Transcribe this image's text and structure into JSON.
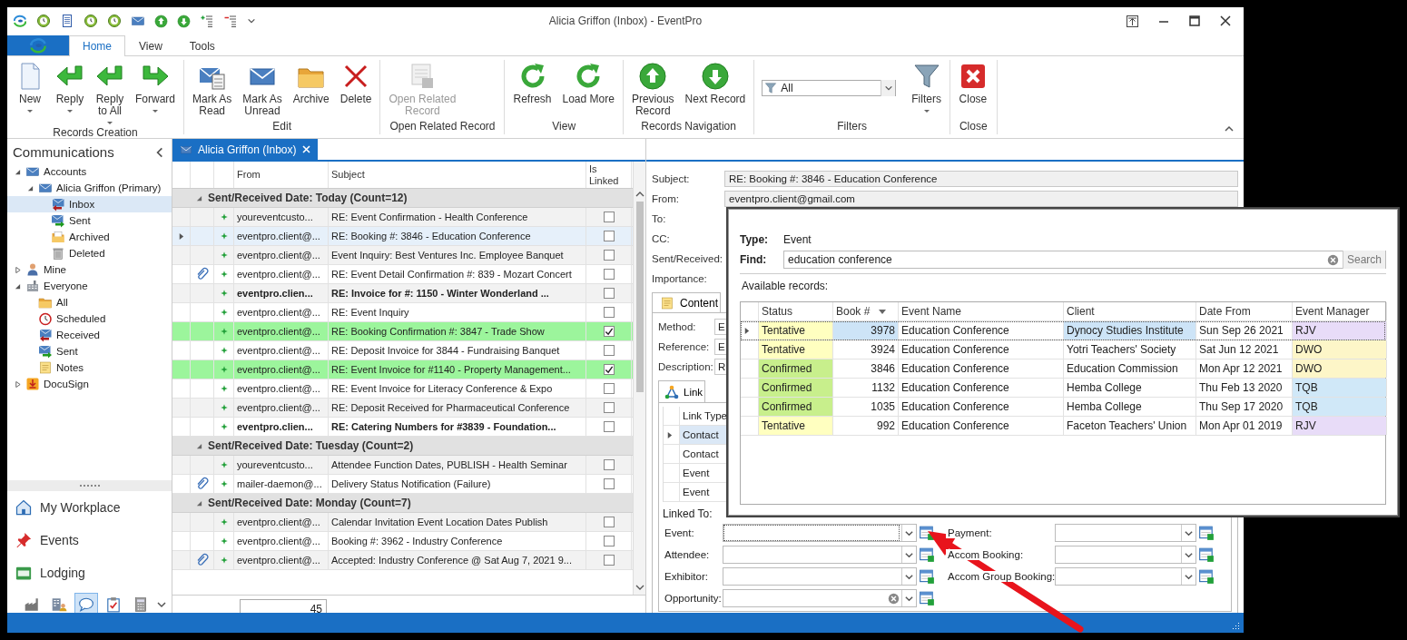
{
  "window": {
    "title": "Alicia Griffon (Inbox) - EventPro"
  },
  "ribbon_tabs": [
    {
      "label": "Home",
      "selected": true
    },
    {
      "label": "View",
      "selected": false
    },
    {
      "label": "Tools",
      "selected": false
    }
  ],
  "ribbon_groups": [
    {
      "title": "Records Creation",
      "buttons": [
        {
          "label": "New",
          "kind": "new",
          "dropdown": true,
          "disabled": false
        },
        {
          "label": "Reply",
          "kind": "reply",
          "dropdown": true,
          "disabled": false
        },
        {
          "label": "Reply\nto All",
          "kind": "reply",
          "dropdown": true,
          "disabled": false
        },
        {
          "label": "Forward",
          "kind": "forward",
          "dropdown": true,
          "disabled": false
        }
      ]
    },
    {
      "title": "Edit",
      "buttons": [
        {
          "label": "Mark As\nRead",
          "kind": "mark-read",
          "dropdown": false,
          "disabled": false
        },
        {
          "label": "Mark As\nUnread",
          "kind": "mail",
          "dropdown": false,
          "disabled": false
        },
        {
          "label": "Archive",
          "kind": "folder",
          "dropdown": false,
          "disabled": false
        },
        {
          "label": "Delete",
          "kind": "delete",
          "dropdown": false,
          "disabled": false
        }
      ]
    },
    {
      "title": "Open Related Record",
      "buttons": [
        {
          "label": "Open Related\nRecord",
          "kind": "record",
          "dropdown": false,
          "disabled": true
        }
      ]
    },
    {
      "title": "View",
      "buttons": [
        {
          "label": "Refresh",
          "kind": "refresh",
          "dropdown": false,
          "disabled": false
        },
        {
          "label": "Load More",
          "kind": "refresh",
          "dropdown": false,
          "disabled": false
        }
      ]
    },
    {
      "title": "Records Navigation",
      "buttons": [
        {
          "label": "Previous\nRecord",
          "kind": "up",
          "dropdown": false,
          "disabled": false
        },
        {
          "label": "Next Record",
          "kind": "down",
          "dropdown": false,
          "disabled": false
        }
      ]
    },
    {
      "title": "Filters",
      "filter": {
        "value": "All"
      },
      "buttons": [
        {
          "label": "Filters",
          "kind": "funnel",
          "dropdown": true,
          "disabled": false
        }
      ]
    },
    {
      "title": "Close",
      "buttons": [
        {
          "label": "Close",
          "kind": "close",
          "dropdown": false,
          "disabled": false
        }
      ]
    }
  ],
  "sidebar": {
    "title": "Communications",
    "tree": [
      {
        "label": "Accounts",
        "kind": "mail",
        "expanded": true,
        "selected": false,
        "children": [
          {
            "label": "Alicia Griffon (Primary)",
            "kind": "mail",
            "expanded": true,
            "selected": false,
            "children": [
              {
                "label": "Inbox",
                "kind": "inbox",
                "selected": true
              },
              {
                "label": "Sent",
                "kind": "sent",
                "selected": false
              },
              {
                "label": "Archived",
                "kind": "archive",
                "selected": false
              },
              {
                "label": "Deleted",
                "kind": "trash",
                "selected": false
              }
            ]
          }
        ]
      },
      {
        "label": "Mine",
        "kind": "person",
        "expanded": false,
        "selected": false
      },
      {
        "label": "Everyone",
        "kind": "building",
        "expanded": true,
        "selected": false,
        "children": [
          {
            "label": "All",
            "kind": "folder",
            "selected": false
          },
          {
            "label": "Scheduled",
            "kind": "clock",
            "selected": false
          },
          {
            "label": "Received",
            "kind": "inbox",
            "selected": false
          },
          {
            "label": "Sent",
            "kind": "sent",
            "selected": false
          },
          {
            "label": "Notes",
            "kind": "notes",
            "selected": false
          }
        ]
      },
      {
        "label": "DocuSign",
        "kind": "docusign",
        "expanded": false,
        "selected": false
      }
    ],
    "nav_buttons": [
      {
        "label": "My Workplace",
        "kind": "home"
      },
      {
        "label": "Events",
        "kind": "pin"
      },
      {
        "label": "Lodging",
        "kind": "bed"
      }
    ],
    "nav_icons": [
      {
        "kind": "factory",
        "selected": false
      },
      {
        "kind": "building-person",
        "selected": false
      },
      {
        "kind": "chat",
        "selected": true
      },
      {
        "kind": "clipboard",
        "selected": false
      },
      {
        "kind": "calculator",
        "selected": false
      }
    ]
  },
  "document_tab": {
    "label": "Alicia Griffon (Inbox)",
    "selected": true
  },
  "email_grid": {
    "columns": [
      "From",
      "Subject",
      "Is\nLinked"
    ],
    "groups": [
      {
        "title": "Sent/Received Date: Today (Count=12)",
        "expanded": true,
        "rows": [
          {
            "from": "youreventcusto...",
            "subject": "RE: Event Confirmation - Health Conference",
            "attachment": false,
            "unread": false,
            "linked": false,
            "selected": false
          },
          {
            "from": "eventpro.client@...",
            "subject": "RE: Booking #: 3846 - Education Conference",
            "attachment": false,
            "unread": false,
            "linked": false,
            "selected": true
          },
          {
            "from": "eventpro.client@...",
            "subject": "Event Inquiry: Best Ventures Inc. Employee Banquet",
            "attachment": false,
            "unread": false,
            "linked": false,
            "selected": false
          },
          {
            "from": "eventpro.client@...",
            "subject": "RE: Event Detail Confirmation #: 839 - Mozart Concert",
            "attachment": true,
            "unread": false,
            "linked": false,
            "selected": false
          },
          {
            "from": "eventpro.clien...",
            "subject": "RE: Invoice for #: 1150 - Winter Wonderland ...",
            "attachment": false,
            "unread": true,
            "linked": false,
            "selected": false
          },
          {
            "from": "eventpro.client@...",
            "subject": "RE: Event Inquiry",
            "attachment": false,
            "unread": false,
            "linked": false,
            "selected": false
          },
          {
            "from": "eventpro.client@...",
            "subject": "RE: Booking Confirmation #: 3847 - Trade Show",
            "attachment": false,
            "unread": false,
            "linked": true,
            "selected": false
          },
          {
            "from": "eventpro.client@...",
            "subject": "RE: Deposit Invoice for 3844 - Fundraising Banquet",
            "attachment": false,
            "unread": false,
            "linked": false,
            "selected": false
          },
          {
            "from": "eventpro.client@...",
            "subject": "RE: Event Invoice for #1140 - Property Management...",
            "attachment": false,
            "unread": false,
            "linked": true,
            "selected": false
          },
          {
            "from": "eventpro.client@...",
            "subject": "RE: Event Invoice for Literacy Conference & Expo",
            "attachment": false,
            "unread": false,
            "linked": false,
            "selected": false
          },
          {
            "from": "eventpro.client@...",
            "subject": "RE: Deposit Received for Pharmaceutical Conference",
            "attachment": false,
            "unread": false,
            "linked": false,
            "selected": false
          },
          {
            "from": "eventpro.clien...",
            "subject": "RE: Catering Numbers for #3839 - Foundation...",
            "attachment": false,
            "unread": true,
            "linked": false,
            "selected": false
          }
        ]
      },
      {
        "title": "Sent/Received Date: Tuesday (Count=2)",
        "expanded": true,
        "rows": [
          {
            "from": "youreventcusto...",
            "subject": "Attendee Function Dates, PUBLISH - Health Seminar",
            "attachment": false,
            "unread": false,
            "linked": false,
            "selected": false
          },
          {
            "from": "mailer-daemon@...",
            "subject": "Delivery Status Notification (Failure)",
            "attachment": true,
            "unread": false,
            "linked": false,
            "selected": false
          }
        ]
      },
      {
        "title": "Sent/Received Date: Monday (Count=7)",
        "expanded": true,
        "rows": [
          {
            "from": "eventpro.client@...",
            "subject": "Calendar Invitation Event Location Dates Publish",
            "attachment": false,
            "unread": false,
            "linked": false,
            "selected": false
          },
          {
            "from": "eventpro.client@...",
            "subject": "Booking #: 3962 - Industry Conference",
            "attachment": false,
            "unread": false,
            "linked": false,
            "selected": false
          },
          {
            "from": "eventpro.client@...",
            "subject": "Accepted: Industry Conference @ Sat Aug 7, 2021 9...",
            "attachment": true,
            "unread": false,
            "linked": false,
            "selected": false
          }
        ]
      }
    ],
    "footer_count": "45"
  },
  "detail": {
    "fields": [
      {
        "label": "Subject:",
        "value": "RE: Booking #: 3846 - Education Conference"
      },
      {
        "label": "From:",
        "value": "eventpro.client@gmail.com"
      },
      {
        "label": "To:"
      },
      {
        "label": "CC:"
      },
      {
        "label": "Sent/Received:"
      },
      {
        "label": "Importance:"
      }
    ],
    "content_tab": "Content",
    "content_fields": [
      {
        "label": "Method:",
        "value": "E"
      },
      {
        "label": "Reference:",
        "value": "E"
      },
      {
        "label": "Description:",
        "value": "R"
      }
    ],
    "link_tab": "Link",
    "link_grid": {
      "column": "Link Type",
      "rows": [
        {
          "text": "Contact",
          "selected": true
        },
        {
          "text": "Contact",
          "selected": false
        },
        {
          "text": "Event",
          "selected": false
        },
        {
          "text": "Event",
          "selected": false
        }
      ]
    },
    "linked_to": "Linked To:",
    "link_fields": [
      {
        "label": "Event:",
        "clearable": false,
        "focused": true
      },
      {
        "label": "Payment:",
        "clearable": false,
        "focused": false
      },
      {
        "label": "Attendee:",
        "clearable": false,
        "focused": false
      },
      {
        "label": "Accom Booking:",
        "clearable": false,
        "focused": false
      },
      {
        "label": "Exhibitor:",
        "clearable": false,
        "focused": false
      },
      {
        "label": "Accom Group Booking:",
        "clearable": false,
        "focused": false
      },
      {
        "label": "Opportunity:",
        "clearable": true,
        "focused": false
      }
    ]
  },
  "lookup": {
    "type_label": "Type:",
    "type_value": "Event",
    "find_label": "Find:",
    "find_value": "education conference",
    "search_button": "Search",
    "available_label": "Available records:",
    "columns": [
      {
        "label": "Status",
        "sorted": false
      },
      {
        "label": "Book #",
        "sorted": true
      },
      {
        "label": "Event Name",
        "sorted": false
      },
      {
        "label": "Client",
        "sorted": false
      },
      {
        "label": "Date From",
        "sorted": false
      },
      {
        "label": "Event Manager",
        "sorted": false
      }
    ],
    "rows": [
      {
        "status": {
          "text": "Tentative",
          "color": "#ffffc0"
        },
        "book": "3978",
        "event": "Education Conference",
        "client": "Dynocy Studies Institute",
        "date": "Sun Sep 26 2021",
        "manager": {
          "text": "RJV",
          "color": "#e8dcf8"
        },
        "selected": true
      },
      {
        "status": {
          "text": "Tentative",
          "color": "#ffffc0"
        },
        "book": "3924",
        "event": "Education Conference",
        "client": "Yotri Teachers' Society",
        "date": "Sat Jun 12 2021",
        "manager": {
          "text": "DWO",
          "color": "#fdf6c8"
        },
        "selected": false
      },
      {
        "status": {
          "text": "Confirmed",
          "color": "#c8ef8c"
        },
        "book": "3846",
        "event": "Education Conference",
        "client": "Education Commission",
        "date": "Mon Apr 12 2021",
        "manager": {
          "text": "DWO",
          "color": "#fdf6c8"
        },
        "selected": false
      },
      {
        "status": {
          "text": "Confirmed",
          "color": "#c8ef8c"
        },
        "book": "1132",
        "event": "Education Conference",
        "client": "Hemba College",
        "date": "Thu Feb 13 2020",
        "manager": {
          "text": "TQB",
          "color": "#d0e8f8"
        },
        "selected": false
      },
      {
        "status": {
          "text": "Confirmed",
          "color": "#c8ef8c"
        },
        "book": "1035",
        "event": "Education Conference",
        "client": "Hemba College",
        "date": "Thu Sep 17 2020",
        "manager": {
          "text": "TQB",
          "color": "#d0e8f8"
        },
        "selected": false
      },
      {
        "status": {
          "text": "Tentative",
          "color": "#ffffc0"
        },
        "book": "992",
        "event": "Education Conference",
        "client": "Faceton Teachers' Union",
        "date": "Mon Apr 01 2019",
        "manager": {
          "text": "RJV",
          "color": "#e8dcf8"
        },
        "selected": false
      }
    ]
  }
}
